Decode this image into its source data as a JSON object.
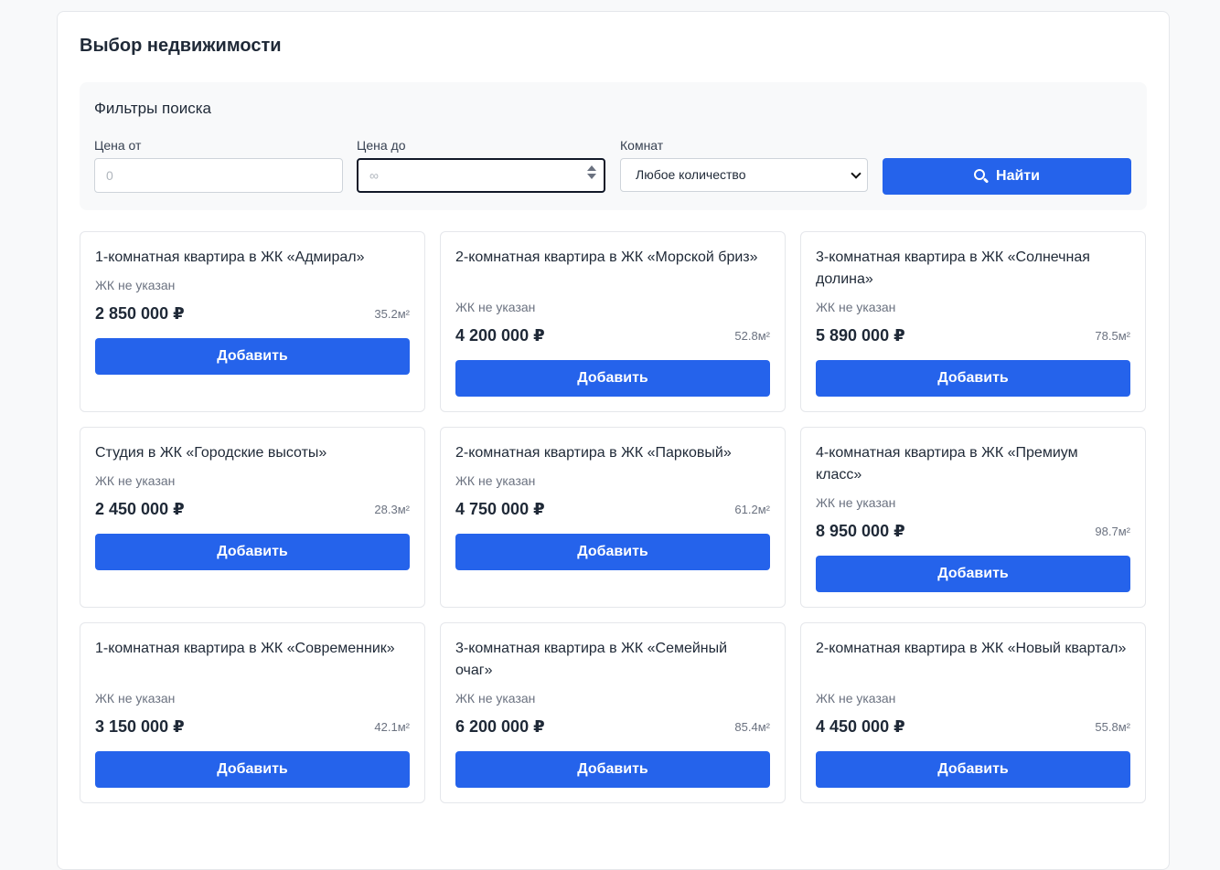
{
  "page_title": "Выбор недвижимости",
  "filters": {
    "title": "Фильтры поиска",
    "price_from": {
      "label": "Цена от",
      "placeholder": "0"
    },
    "price_to": {
      "label": "Цена до",
      "placeholder": "∞"
    },
    "rooms": {
      "label": "Комнат",
      "selected": "Любое количество"
    },
    "search_button": "Найти"
  },
  "accent_color": "#2563eb",
  "add_label": "Добавить",
  "cards": [
    {
      "title": "1-комнатная квартира в ЖК «Адмирал»",
      "subtitle": "ЖК не указан",
      "price": "2 850 000 ₽",
      "area": "35.2м²"
    },
    {
      "title": "2-комнатная квартира в ЖК «Морской бриз»",
      "subtitle": "ЖК не указан",
      "price": "4 200 000 ₽",
      "area": "52.8м²"
    },
    {
      "title": "3-комнатная квартира в ЖК «Солнечная долина»",
      "subtitle": "ЖК не указан",
      "price": "5 890 000 ₽",
      "area": "78.5м²"
    },
    {
      "title": "Студия в ЖК «Городские высоты»",
      "subtitle": "ЖК не указан",
      "price": "2 450 000 ₽",
      "area": "28.3м²"
    },
    {
      "title": "2-комнатная квартира в ЖК «Парковый»",
      "subtitle": "ЖК не указан",
      "price": "4 750 000 ₽",
      "area": "61.2м²"
    },
    {
      "title": "4-комнатная квартира в ЖК «Премиум класс»",
      "subtitle": "ЖК не указан",
      "price": "8 950 000 ₽",
      "area": "98.7м²"
    },
    {
      "title": "1-комнатная квартира в ЖК «Современник»",
      "subtitle": "ЖК не указан",
      "price": "3 150 000 ₽",
      "area": "42.1м²"
    },
    {
      "title": "3-комнатная квартира в ЖК «Семейный очаг»",
      "subtitle": "ЖК не указан",
      "price": "6 200 000 ₽",
      "area": "85.4м²"
    },
    {
      "title": "2-комнатная квартира в ЖК «Новый квартал»",
      "subtitle": "ЖК не указан",
      "price": "4 450 000 ₽",
      "area": "55.8м²"
    }
  ]
}
